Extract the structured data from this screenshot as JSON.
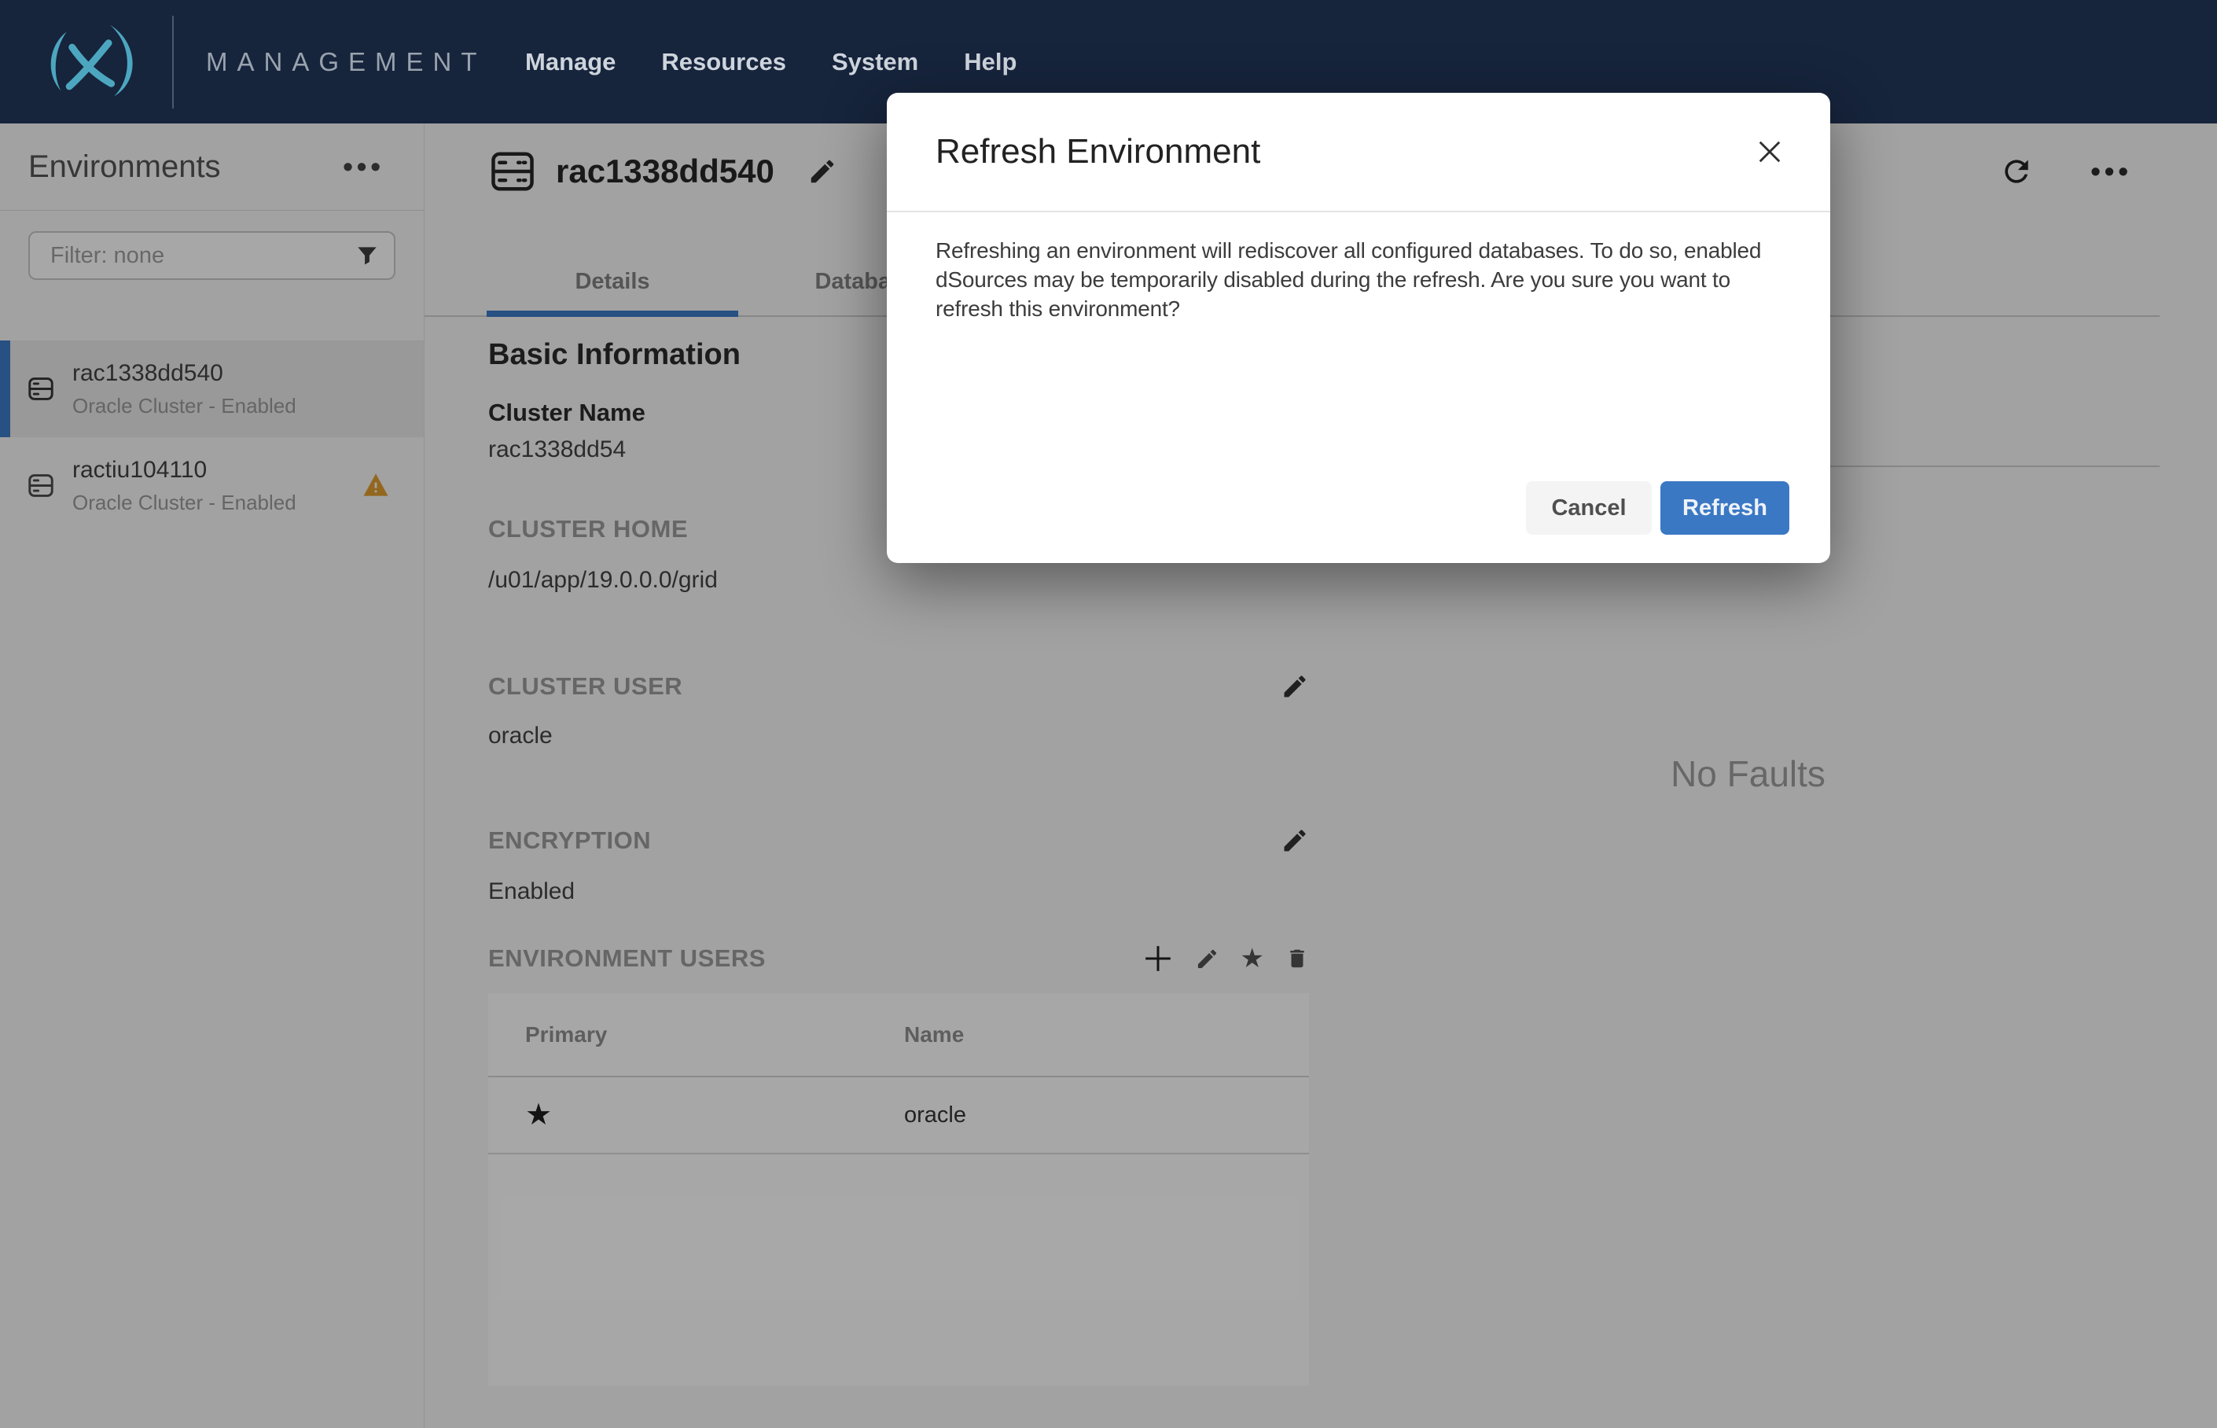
{
  "nav": {
    "product": "MANAGEMENT",
    "items": [
      {
        "label": "Manage"
      },
      {
        "label": "Resources"
      },
      {
        "label": "System"
      },
      {
        "label": "Help"
      }
    ]
  },
  "sidebar": {
    "title": "Environments",
    "filter_placeholder": "Filter: none",
    "items": [
      {
        "name": "rac1338dd540",
        "status": "Oracle Cluster - Enabled",
        "selected": true,
        "warning": false
      },
      {
        "name": "ractiu104110",
        "status": "Oracle Cluster - Enabled",
        "selected": false,
        "warning": true
      }
    ]
  },
  "content": {
    "title": "rac1338dd540",
    "tabs": [
      {
        "label": "Details",
        "active": true
      },
      {
        "label": "Databases",
        "active": false
      }
    ],
    "sections": {
      "basic_information_heading": "Basic Information",
      "cluster_name_label": "Cluster Name",
      "cluster_name_value": "rac1338dd54",
      "cluster_home_label": "CLUSTER HOME",
      "cluster_home_value": "/u01/app/19.0.0.0/grid",
      "cluster_user_label": "CLUSTER USER",
      "cluster_user_value": "oracle",
      "encryption_label": "ENCRYPTION",
      "encryption_value": "Enabled",
      "environment_users_label": "ENVIRONMENT USERS"
    },
    "users_table": {
      "columns": [
        "Primary",
        "Name"
      ],
      "rows": [
        {
          "primary": true,
          "name": "oracle"
        }
      ]
    },
    "faults": {
      "empty_text": "No Faults"
    }
  },
  "modal": {
    "title": "Refresh Environment",
    "body": "Refreshing an environment will rediscover all configured databases. To do so, enabled dSources may be temporarily disabled during the refresh. Are you sure you want to refresh this environment?",
    "cancel_label": "Cancel",
    "confirm_label": "Refresh"
  },
  "icons": {
    "ellipsis": "•••",
    "star_filled": "★"
  },
  "colors": {
    "nav_bg": "#16243c",
    "logo_teal": "#4da6c0",
    "accent_blue": "#3b78c4",
    "warning_orange": "#dd9a2d"
  }
}
